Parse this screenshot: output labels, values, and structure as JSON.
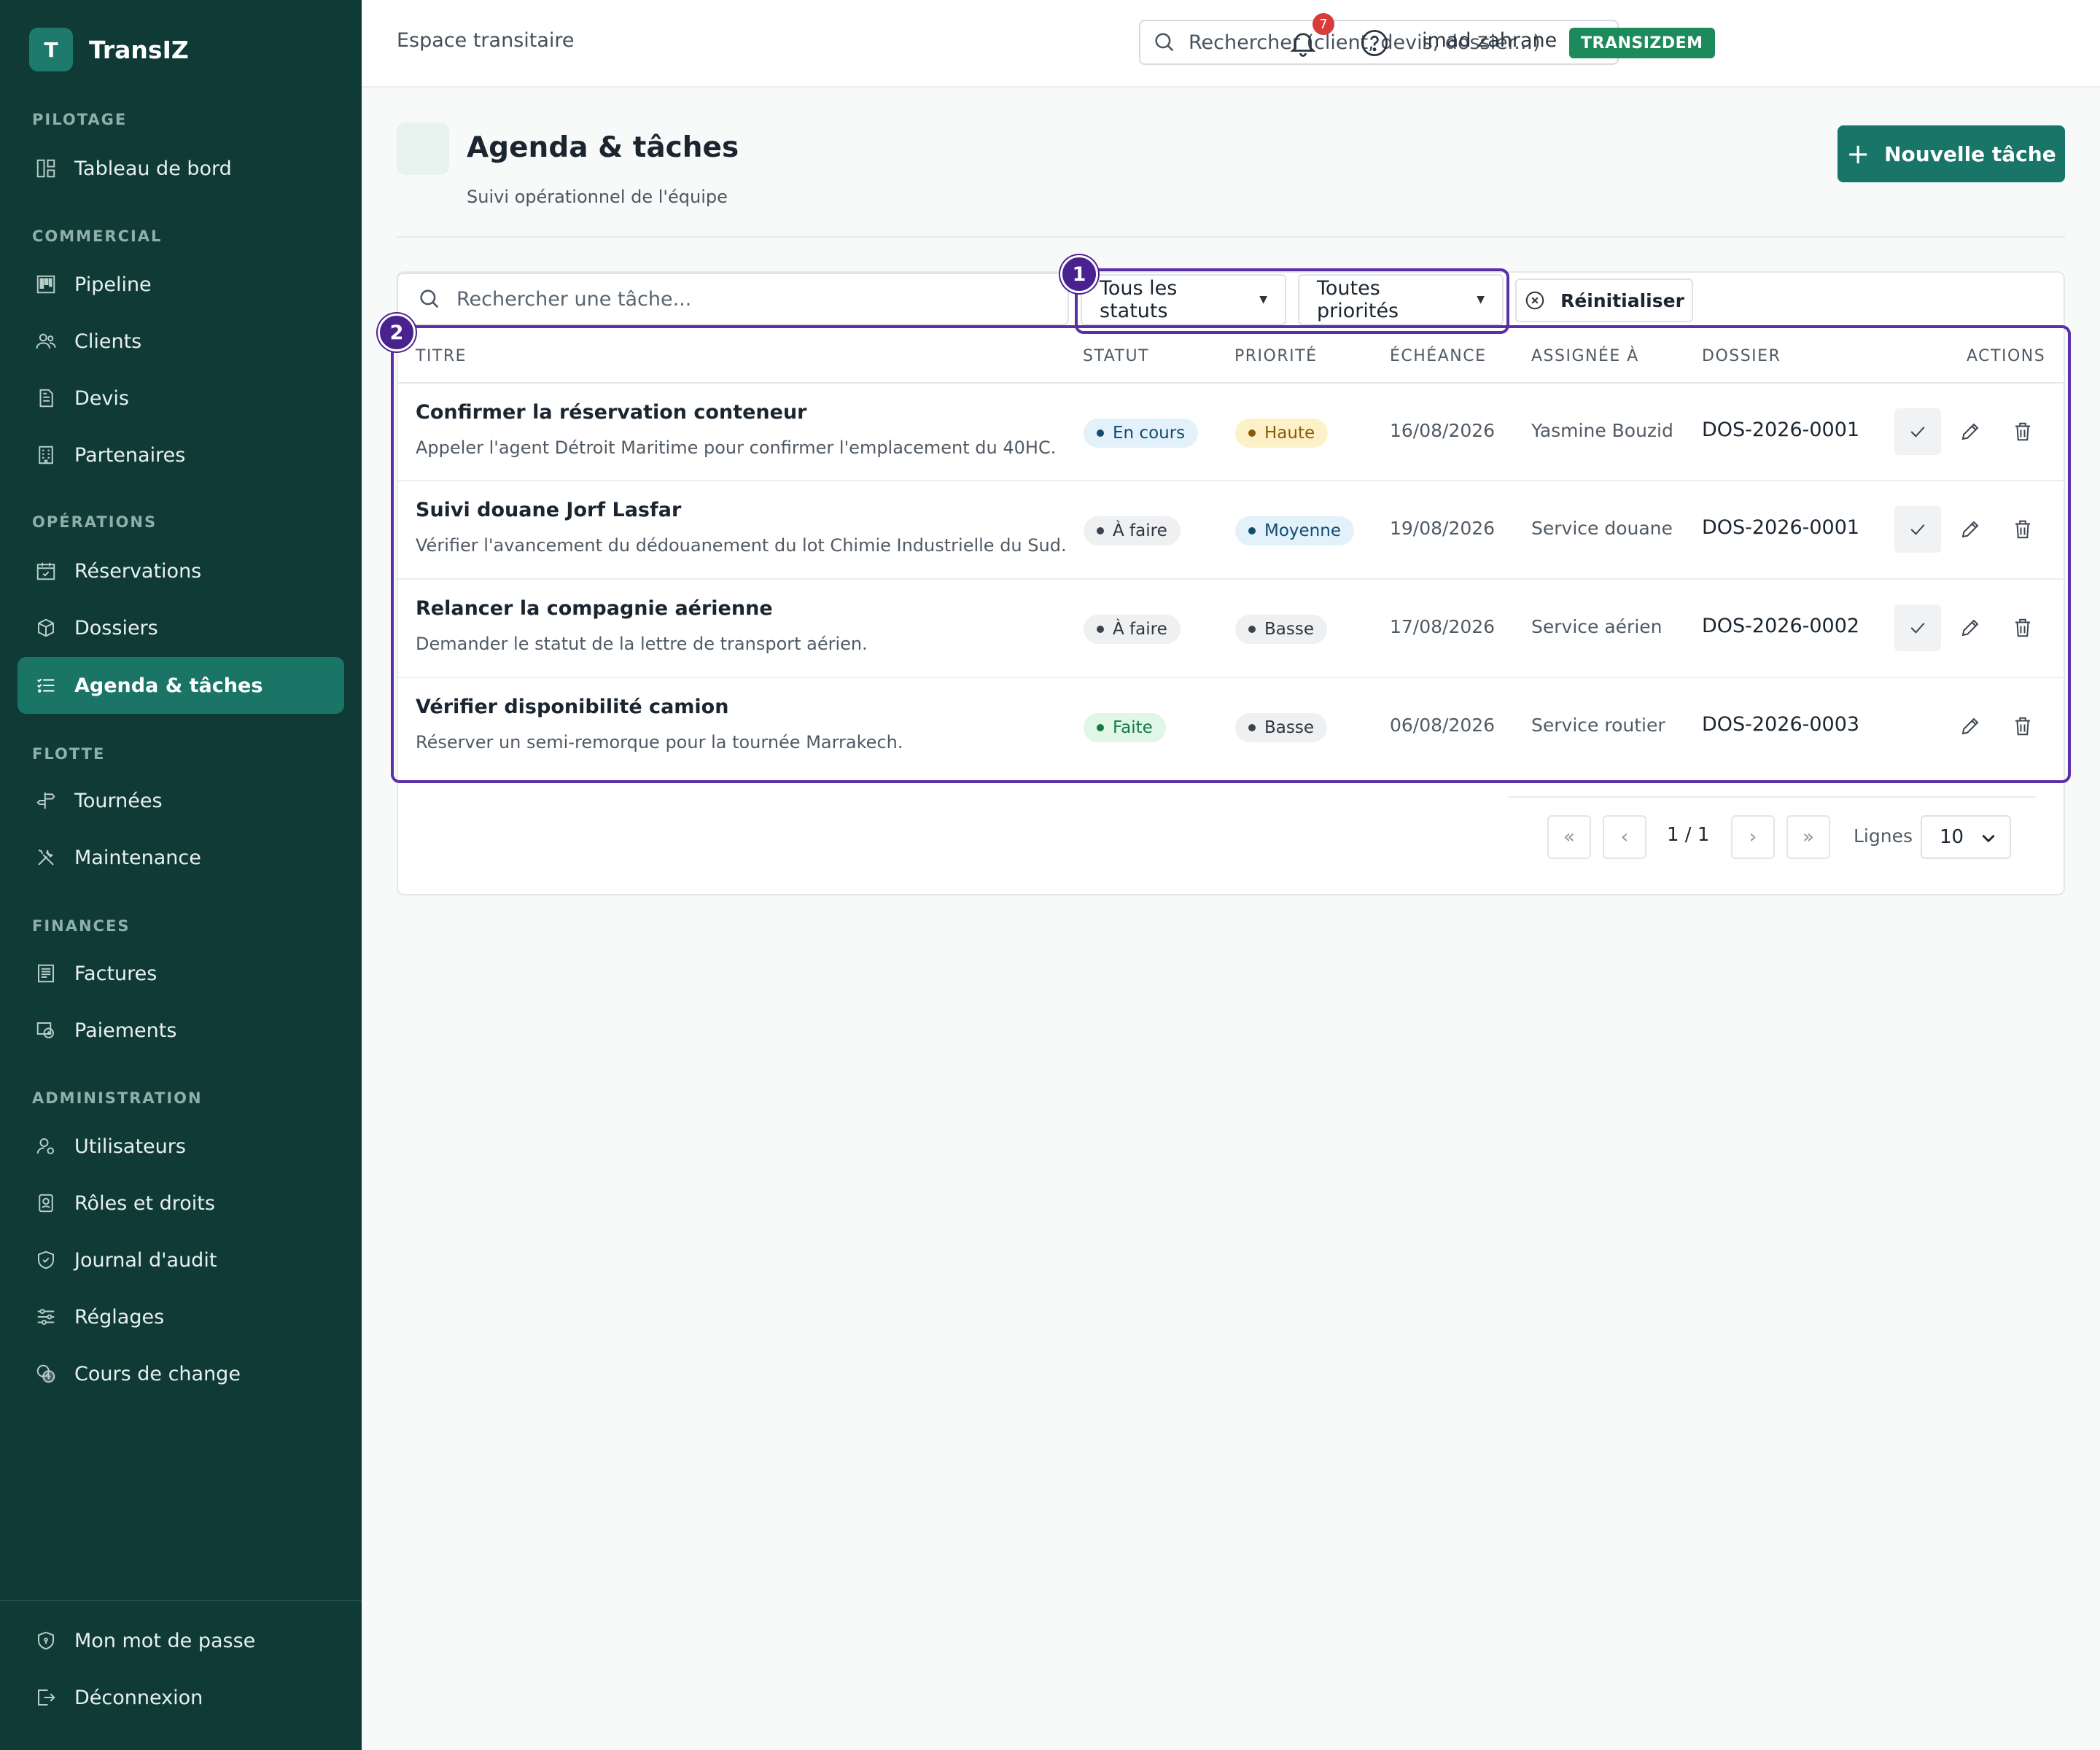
{
  "brand": {
    "logo_letter": "T",
    "name": "TransIZ"
  },
  "sidebar": {
    "sections": {
      "pilotage": "PILOTAGE",
      "commercial": "COMMERCIAL",
      "operations": "OPÉRATIONS",
      "flotte": "FLOTTE",
      "finances": "FINANCES",
      "administration": "ADMINISTRATION"
    },
    "items": {
      "dashboard": "Tableau de bord",
      "pipeline": "Pipeline",
      "clients": "Clients",
      "devis": "Devis",
      "partenaires": "Partenaires",
      "reservations": "Réservations",
      "dossiers": "Dossiers",
      "agenda": "Agenda & tâches",
      "tournees": "Tournées",
      "maintenance": "Maintenance",
      "factures": "Factures",
      "paiements": "Paiements",
      "utilisateurs": "Utilisateurs",
      "roles": "Rôles et droits",
      "audit": "Journal d'audit",
      "reglages": "Réglages",
      "change": "Cours de change",
      "password": "Mon mot de passe",
      "logout": "Déconnexion"
    }
  },
  "topbar": {
    "breadcrumb": "Espace transitaire",
    "search_placeholder": "Rechercher (client, devis, dossier...)",
    "notifications_count": "7",
    "username": "imad zahrane",
    "tenant": "TRANSIZDEM"
  },
  "header": {
    "title": "Agenda & tâches",
    "subtitle": "Suivi opérationnel de l'équipe",
    "new_task_label": "Nouvelle tâche"
  },
  "filters": {
    "search_placeholder": "Rechercher une tâche...",
    "status_selected": "Tous les statuts",
    "priority_selected": "Toutes priorités",
    "reset_label": "Réinitialiser"
  },
  "table": {
    "columns": {
      "title": "TITRE",
      "status": "STATUT",
      "priority": "PRIORITÉ",
      "due": "ÉCHÉANCE",
      "assignee": "ASSIGNÉE À",
      "dossier": "DOSSIER",
      "actions": "ACTIONS"
    },
    "rows": [
      {
        "title": "Confirmer la réservation conteneur",
        "description": "Appeler l'agent Détroit Maritime pour confirmer l'emplacement du 40HC.",
        "status": "En cours",
        "priority": "Haute",
        "due": "16/08/2026",
        "assignee": "Yasmine Bouzid",
        "dossier": "DOS-2026-0001"
      },
      {
        "title": "Suivi douane Jorf Lasfar",
        "description": "Vérifier l'avancement du dédouanement du lot Chimie Industrielle du Sud.",
        "status": "À faire",
        "priority": "Moyenne",
        "due": "19/08/2026",
        "assignee": "Service douane",
        "dossier": "DOS-2026-0001"
      },
      {
        "title": "Relancer la compagnie aérienne",
        "description": "Demander le statut de la lettre de transport aérien.",
        "status": "À faire",
        "priority": "Basse",
        "due": "17/08/2026",
        "assignee": "Service aérien",
        "dossier": "DOS-2026-0002"
      },
      {
        "title": "Vérifier disponibilité camion",
        "description": "Réserver un semi-remorque pour la tournée Marrakech.",
        "status": "Faite",
        "priority": "Basse",
        "due": "06/08/2026",
        "assignee": "Service routier",
        "dossier": "DOS-2026-0003"
      }
    ]
  },
  "pagination": {
    "first": "«",
    "prev": "‹",
    "page_info": "1 / 1",
    "next": "›",
    "last": "»",
    "lines_label": "Lignes",
    "lines_value": "10"
  },
  "annotations": {
    "badge_1": "1",
    "badge_2": "2"
  },
  "colors": {
    "sidebar_bg": "#0f3a36",
    "accent": "#187567",
    "tenant_badge": "#1d8a5b",
    "highlight": "#5b2fa8"
  }
}
